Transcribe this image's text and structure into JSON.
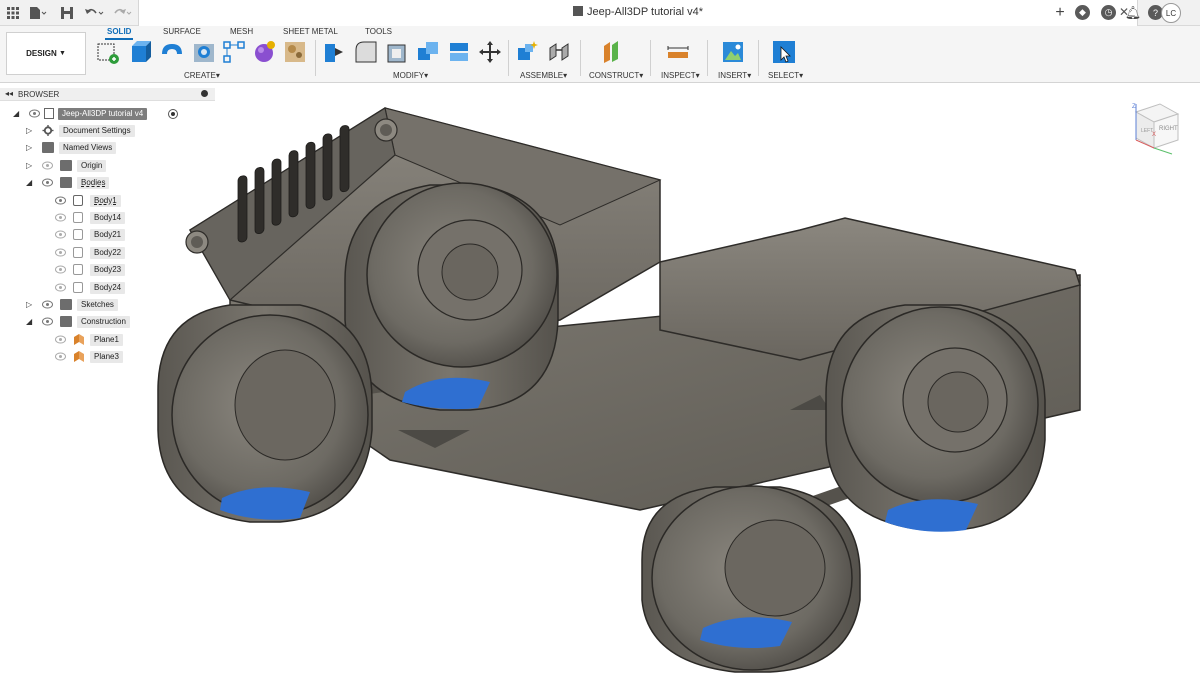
{
  "title_bar": {
    "document_title": "Jeep-All3DP tutorial v4*",
    "avatar_initials": "LC",
    "icons": [
      "app-grid-icon",
      "file-menu-icon",
      "save-icon",
      "undo-icon",
      "redo-icon",
      "new-tab-icon",
      "extensions-icon",
      "job-status-icon",
      "notifications-icon",
      "help-icon"
    ]
  },
  "toolbar": {
    "workspace_label": "DESIGN",
    "workspace_tabs": [
      "SOLID",
      "SURFACE",
      "MESH",
      "SHEET METAL",
      "TOOLS"
    ],
    "active_tab": "SOLID",
    "groups": {
      "create": "CREATE",
      "modify": "MODIFY",
      "assemble": "ASSEMBLE",
      "construct": "CONSTRUCT",
      "inspect": "INSPECT",
      "insert": "INSERT",
      "select": "SELECT"
    },
    "dropdown_glyph": "▾"
  },
  "browser": {
    "title": "BROWSER",
    "root": "Jeep-All3DP tutorial v4",
    "items": [
      {
        "label": "Document Settings"
      },
      {
        "label": "Named Views"
      },
      {
        "label": "Origin"
      },
      {
        "label": "Bodies"
      },
      {
        "label": "Body1"
      },
      {
        "label": "Body14"
      },
      {
        "label": "Body21"
      },
      {
        "label": "Body22"
      },
      {
        "label": "Body23"
      },
      {
        "label": "Body24"
      },
      {
        "label": "Sketches"
      },
      {
        "label": "Construction"
      },
      {
        "label": "Plane1"
      },
      {
        "label": "Plane3"
      }
    ]
  },
  "viewcube": {
    "top_label": "TOP",
    "front_label": "LEFT",
    "right_label": "RIGHT",
    "axis_z": "Z",
    "axis_x": "X"
  },
  "colors": {
    "accent": "#0f6db8",
    "body_gray": "#6f6b63",
    "highlight_blue": "#2f6fd1"
  }
}
